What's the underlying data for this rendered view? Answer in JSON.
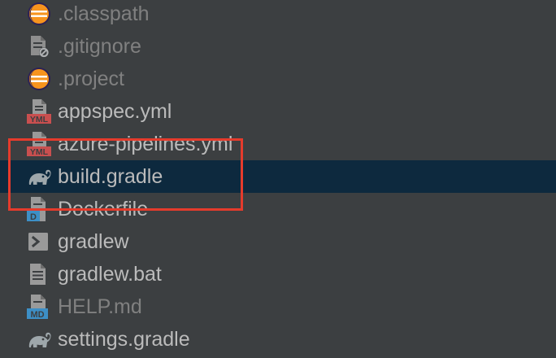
{
  "accent": {
    "selection_bg": "#0d293e",
    "highlight_border": "#e53b2c",
    "text": "#bbbbbb",
    "muted_text": "#808080",
    "panel_bg": "#3c3f41"
  },
  "file_tree": {
    "items": [
      {
        "label": ".classpath",
        "icon": "eclipse-icon",
        "muted": true
      },
      {
        "label": ".gitignore",
        "icon": "ignored-file-icon",
        "muted": true
      },
      {
        "label": ".project",
        "icon": "eclipse-icon",
        "muted": true
      },
      {
        "label": "appspec.yml",
        "icon": "yml-file-icon",
        "icon_text": "YML"
      },
      {
        "label": "azure-pipelines.yml",
        "icon": "yml-file-icon",
        "icon_text": "YML"
      },
      {
        "label": "build.gradle",
        "icon": "gradle-elephant-icon",
        "selected": true
      },
      {
        "label": "Dockerfile",
        "icon": "docker-file-icon",
        "icon_text": "D"
      },
      {
        "label": "gradlew",
        "icon": "shell-script-icon"
      },
      {
        "label": "gradlew.bat",
        "icon": "text-file-icon"
      },
      {
        "label": "HELP.md",
        "icon": "markdown-file-icon",
        "icon_text": "MD",
        "muted": true
      },
      {
        "label": "settings.gradle",
        "icon": "gradle-elephant-icon"
      }
    ]
  }
}
